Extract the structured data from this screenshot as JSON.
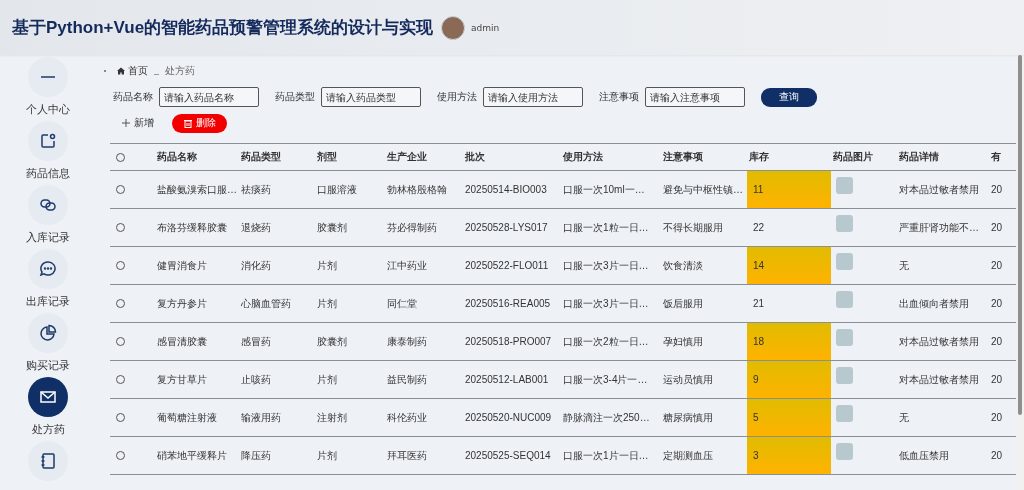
{
  "header": {
    "title": "基于Python+Vue的智能药品预警管理系统的设计与实现",
    "user": "admin"
  },
  "sidebar": {
    "items": [
      {
        "label": "个人中心",
        "selected": false
      },
      {
        "label": "药品信息",
        "selected": false
      },
      {
        "label": "入库记录",
        "selected": false
      },
      {
        "label": "出库记录",
        "selected": false
      },
      {
        "label": "购买记录",
        "selected": false
      },
      {
        "label": "处方药",
        "selected": true
      },
      {
        "selected": false
      }
    ]
  },
  "breadcrumb": [
    "首页",
    "处方药"
  ],
  "search": {
    "fields": [
      {
        "label": "药品名称",
        "placeholder": "请输入药品名称"
      },
      {
        "label": "药品类型",
        "placeholder": "请输入药品类型"
      },
      {
        "label": "使用方法",
        "placeholder": "请输入使用方法"
      },
      {
        "label": "注意事项",
        "placeholder": "请输入注意事项"
      }
    ],
    "button": "查询"
  },
  "actions": {
    "add": "新增",
    "delete": "删除"
  },
  "table": {
    "select_all": {
      "selected": false
    },
    "columns": [
      "药品名称",
      "药品类型",
      "剂型",
      "生产企业",
      "批次",
      "使用方法",
      "注意事项",
      "库存",
      "药品图片",
      "药品详情",
      "有"
    ],
    "rows": [
      {
        "selected": false,
        "cells": [
          "盐酸氨溴索口服…",
          "祛痰药",
          "口服溶液",
          "勃林格殷格翰",
          "20250514-BIO003",
          "口服一次10ml一…",
          "避免与中枢性镇…",
          "11",
          "",
          "对本品过敏者禁用",
          "20"
        ],
        "low_stock": true
      },
      {
        "selected": false,
        "cells": [
          "布洛芬缓释胶囊",
          "退烧药",
          "胶囊剂",
          "芬必得制药",
          "20250528-LYS017",
          "口服一次1粒一日…",
          "不得长期服用",
          "22",
          "",
          "严重肝肾功能不…",
          "20"
        ],
        "low_stock": false
      },
      {
        "selected": false,
        "cells": [
          "健胃消食片",
          "消化药",
          "片剂",
          "江中药业",
          "20250522-FLO011",
          "口服一次3片一日…",
          "饮食清淡",
          "14",
          "",
          "无",
          "20"
        ],
        "low_stock": true
      },
      {
        "selected": false,
        "cells": [
          "复方丹参片",
          "心脑血管药",
          "片剂",
          "同仁堂",
          "20250516-REA005",
          "口服一次3片一日…",
          "饭后服用",
          "21",
          "",
          "出血倾向者禁用",
          "20"
        ],
        "low_stock": false
      },
      {
        "selected": false,
        "cells": [
          "感冒清胶囊",
          "感冒药",
          "胶囊剂",
          "康泰制药",
          "20250518-PRO007",
          "口服一次2粒一日…",
          "孕妇慎用",
          "18",
          "",
          "对本品过敏者禁用",
          "20"
        ],
        "low_stock": true
      },
      {
        "selected": false,
        "cells": [
          "复方甘草片",
          "止咳药",
          "片剂",
          "益民制药",
          "20250512-LAB001",
          "口服一次3-4片一…",
          "运动员慎用",
          "9",
          "",
          "对本品过敏者禁用",
          "20"
        ],
        "low_stock": true
      },
      {
        "selected": false,
        "cells": [
          "葡萄糖注射液",
          "输液用药",
          "注射剂",
          "科伦药业",
          "20250520-NUC009",
          "静脉滴注一次250…",
          "糖尿病慎用",
          "5",
          "",
          "无",
          "20"
        ],
        "low_stock": true
      },
      {
        "selected": false,
        "cells": [
          "硝苯地平缓释片",
          "降压药",
          "片剂",
          "拜耳医药",
          "20250525-SEQ014",
          "口服一次1片一日…",
          "定期测血压",
          "3",
          "",
          "低血压禁用",
          "20"
        ],
        "low_stock": true
      }
    ]
  }
}
